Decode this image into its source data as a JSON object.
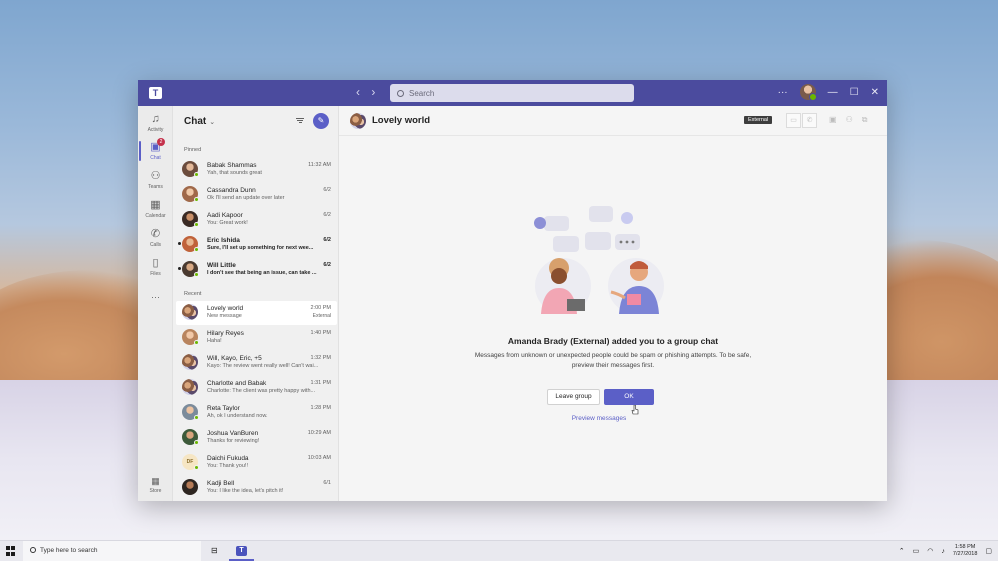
{
  "window": {
    "search_placeholder": "Search",
    "nav_back": "‹",
    "nav_forward": "›",
    "more": "···",
    "minimize": "—",
    "maximize": "☐",
    "close": "✕"
  },
  "rail": {
    "items": [
      {
        "label": "Activity",
        "icon": "bell-icon"
      },
      {
        "label": "Chat",
        "icon": "chat-icon",
        "badge": "2"
      },
      {
        "label": "Teams",
        "icon": "teams-icon"
      },
      {
        "label": "Calendar",
        "icon": "calendar-icon"
      },
      {
        "label": "Calls",
        "icon": "phone-icon"
      },
      {
        "label": "Files",
        "icon": "file-icon"
      }
    ],
    "more": "···",
    "store_label": "Store"
  },
  "chatlist": {
    "title": "Chat",
    "pinned_label": "Pinned",
    "recent_label": "Recent",
    "pinned": [
      {
        "name": "Babak Shammas",
        "preview": "Yah, that sounds great",
        "time": "11:32 AM"
      },
      {
        "name": "Cassandra Dunn",
        "preview": "Ok I'll send an update over later",
        "time": "6/2"
      },
      {
        "name": "Aadi Kapoor",
        "preview": "You: Great work!",
        "time": "6/2"
      },
      {
        "name": "Eric Ishida",
        "preview": "Sure, I'll set up something for next wee...",
        "time": "6/2"
      },
      {
        "name": "Will Little",
        "preview": "I don't see that being an issue, can take ...",
        "time": "6/2"
      }
    ],
    "recent": [
      {
        "name": "Lovely world",
        "preview": "New message",
        "time": "2:00 PM",
        "tag": "External"
      },
      {
        "name": "Hilary Reyes",
        "preview": "Haha!",
        "time": "1:40 PM"
      },
      {
        "name": "Will, Kayo, Eric, +5",
        "preview": "Kayo: The review went really well! Can't wai...",
        "time": "1:32 PM"
      },
      {
        "name": "Charlotte and Babak",
        "preview": "Charlotte: The client was pretty happy with...",
        "time": "1:31 PM"
      },
      {
        "name": "Reta Taylor",
        "preview": "Ah, ok I understand now.",
        "time": "1:28 PM"
      },
      {
        "name": "Joshua VanBuren",
        "preview": "Thanks for reviewing!",
        "time": "10:29 AM"
      },
      {
        "name": "Daichi Fukuda",
        "preview": "You: Thank you!!",
        "time": "10:03 AM",
        "initials": "DF"
      },
      {
        "name": "Kadji Bell",
        "preview": "You: I like the idea, let's pitch it!",
        "time": "6/1"
      }
    ]
  },
  "main": {
    "title": "Lovely world",
    "external_badge": "External",
    "heading": "Amanda Brady (External) added you to a group chat",
    "body": "Messages from unknown or unexpected people could be spam or phishing attempts. To be safe, preview their messages first.",
    "leave_button": "Leave group",
    "ok_button": "OK",
    "preview_link": "Preview messages"
  },
  "taskbar": {
    "search_placeholder": "Type here to search",
    "time": "1:58 PM",
    "date": "7/27/2018"
  },
  "colors": {
    "titlebar": "#4b4b9e",
    "accent": "#5b5fc7",
    "presence": "#6bb700"
  }
}
